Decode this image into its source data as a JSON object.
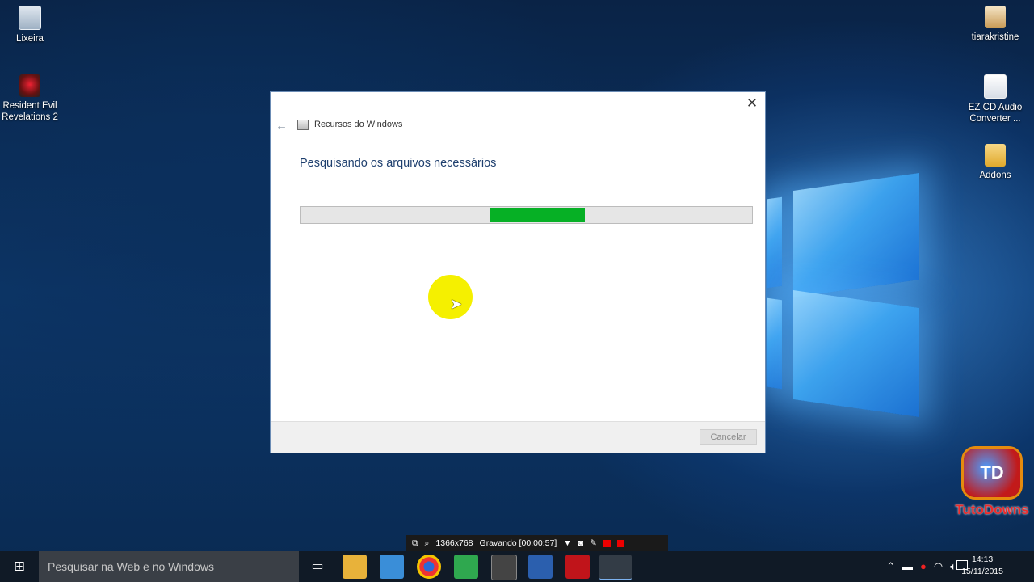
{
  "desktop": {
    "icons_left": [
      {
        "label": "Lixeira",
        "icon": "recycle-bin-icon"
      },
      {
        "label": "Resident Evil Revelations 2",
        "icon": "game-icon"
      }
    ],
    "icons_right": [
      {
        "label": "tiarakristine",
        "icon": "user-folder-icon"
      },
      {
        "label": "EZ CD Audio Converter ...",
        "icon": "document-icon"
      },
      {
        "label": "Addons",
        "icon": "folder-icon"
      }
    ]
  },
  "dialog": {
    "window_title": "Recursos do Windows",
    "heading": "Pesquisando os arquivos necessários",
    "progress": {
      "indeterminate": true,
      "segment_start": 0.42,
      "segment_width": 0.21,
      "color": "#06b025"
    },
    "cancel_label": "Cancelar"
  },
  "recorder": {
    "resolution": "1366x768",
    "status": "Gravando [00:00:57]"
  },
  "taskbar": {
    "search_placeholder": "Pesquisar na Web e no Windows",
    "apps": [
      "task-view-icon",
      "file-explorer-icon",
      "edge-icon",
      "chrome-icon",
      "greenshot-icon",
      "app-icon",
      "word-icon",
      "office-icon",
      "notepad-icon"
    ],
    "time": "14:13",
    "date": "15/11/2015"
  },
  "watermark": {
    "logo_text": "TD",
    "brand": "TutoDowns"
  }
}
